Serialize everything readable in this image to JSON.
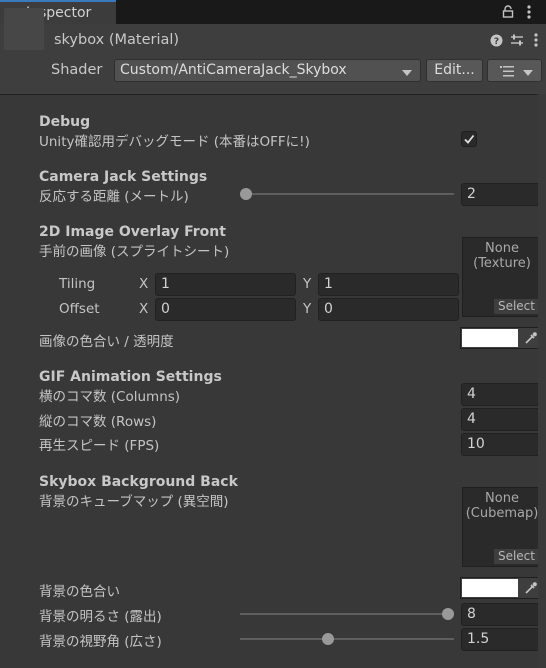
{
  "tab": {
    "label": "Inspector"
  },
  "header": {
    "title": "skybox (Material)",
    "shader_label": "Shader",
    "shader_value": "Custom/AntiCameraJack_Skybox",
    "edit_label": "Edit..."
  },
  "debug": {
    "heading": "Debug",
    "mode_label": "Unity確認用デバッグモード (本番はOFFに!)",
    "mode_checked": true
  },
  "camera_jack": {
    "heading": "Camera Jack Settings",
    "distance_label": "反応する距離 (メートル)",
    "distance_value": "2"
  },
  "overlay_front": {
    "heading": "2D Image Overlay Front",
    "image_label": "手前の画像 (スプライトシート)",
    "texture_text": "None\n(Texture)",
    "select_label": "Select",
    "tiling_label": "Tiling",
    "offset_label": "Offset",
    "x_label": "X",
    "y_label": "Y",
    "tiling_x": "1",
    "tiling_y": "1",
    "offset_x": "0",
    "offset_y": "0",
    "tint_label": "画像の色合い / 透明度",
    "tint_color": "#ffffff"
  },
  "gif": {
    "heading": "GIF Animation Settings",
    "columns_label": "横のコマ数 (Columns)",
    "columns_value": "4",
    "rows_label": "縦のコマ数 (Rows)",
    "rows_value": "4",
    "fps_label": "再生スピード (FPS)",
    "fps_value": "10"
  },
  "skybox_back": {
    "heading": "Skybox Background Back",
    "cubemap_label": "背景のキューブマップ (異空間)",
    "cubemap_text": "None\n(Cubemap)",
    "select_label": "Select",
    "color_label": "背景の色合い",
    "color_value": "#ffffff",
    "brightness_label": "背景の明るさ (露出)",
    "brightness_value": "8",
    "fov_label": "背景の視野角 (広さ)",
    "fov_value": "1.5"
  },
  "sliders": {
    "distance": {
      "fraction": 0.0
    },
    "brightness": {
      "fraction": 1.0
    },
    "fov": {
      "fraction": 0.41
    }
  },
  "colors": {
    "accent": "#3a79bb",
    "background": "#383838",
    "field": "#2a2a2a"
  },
  "icons": [
    "info-icon",
    "lock-icon",
    "menu-dots-icon",
    "help-icon",
    "settings-sliders-icon",
    "material-icon",
    "list-icon",
    "eyedropper-icon",
    "checkmark-icon"
  ]
}
